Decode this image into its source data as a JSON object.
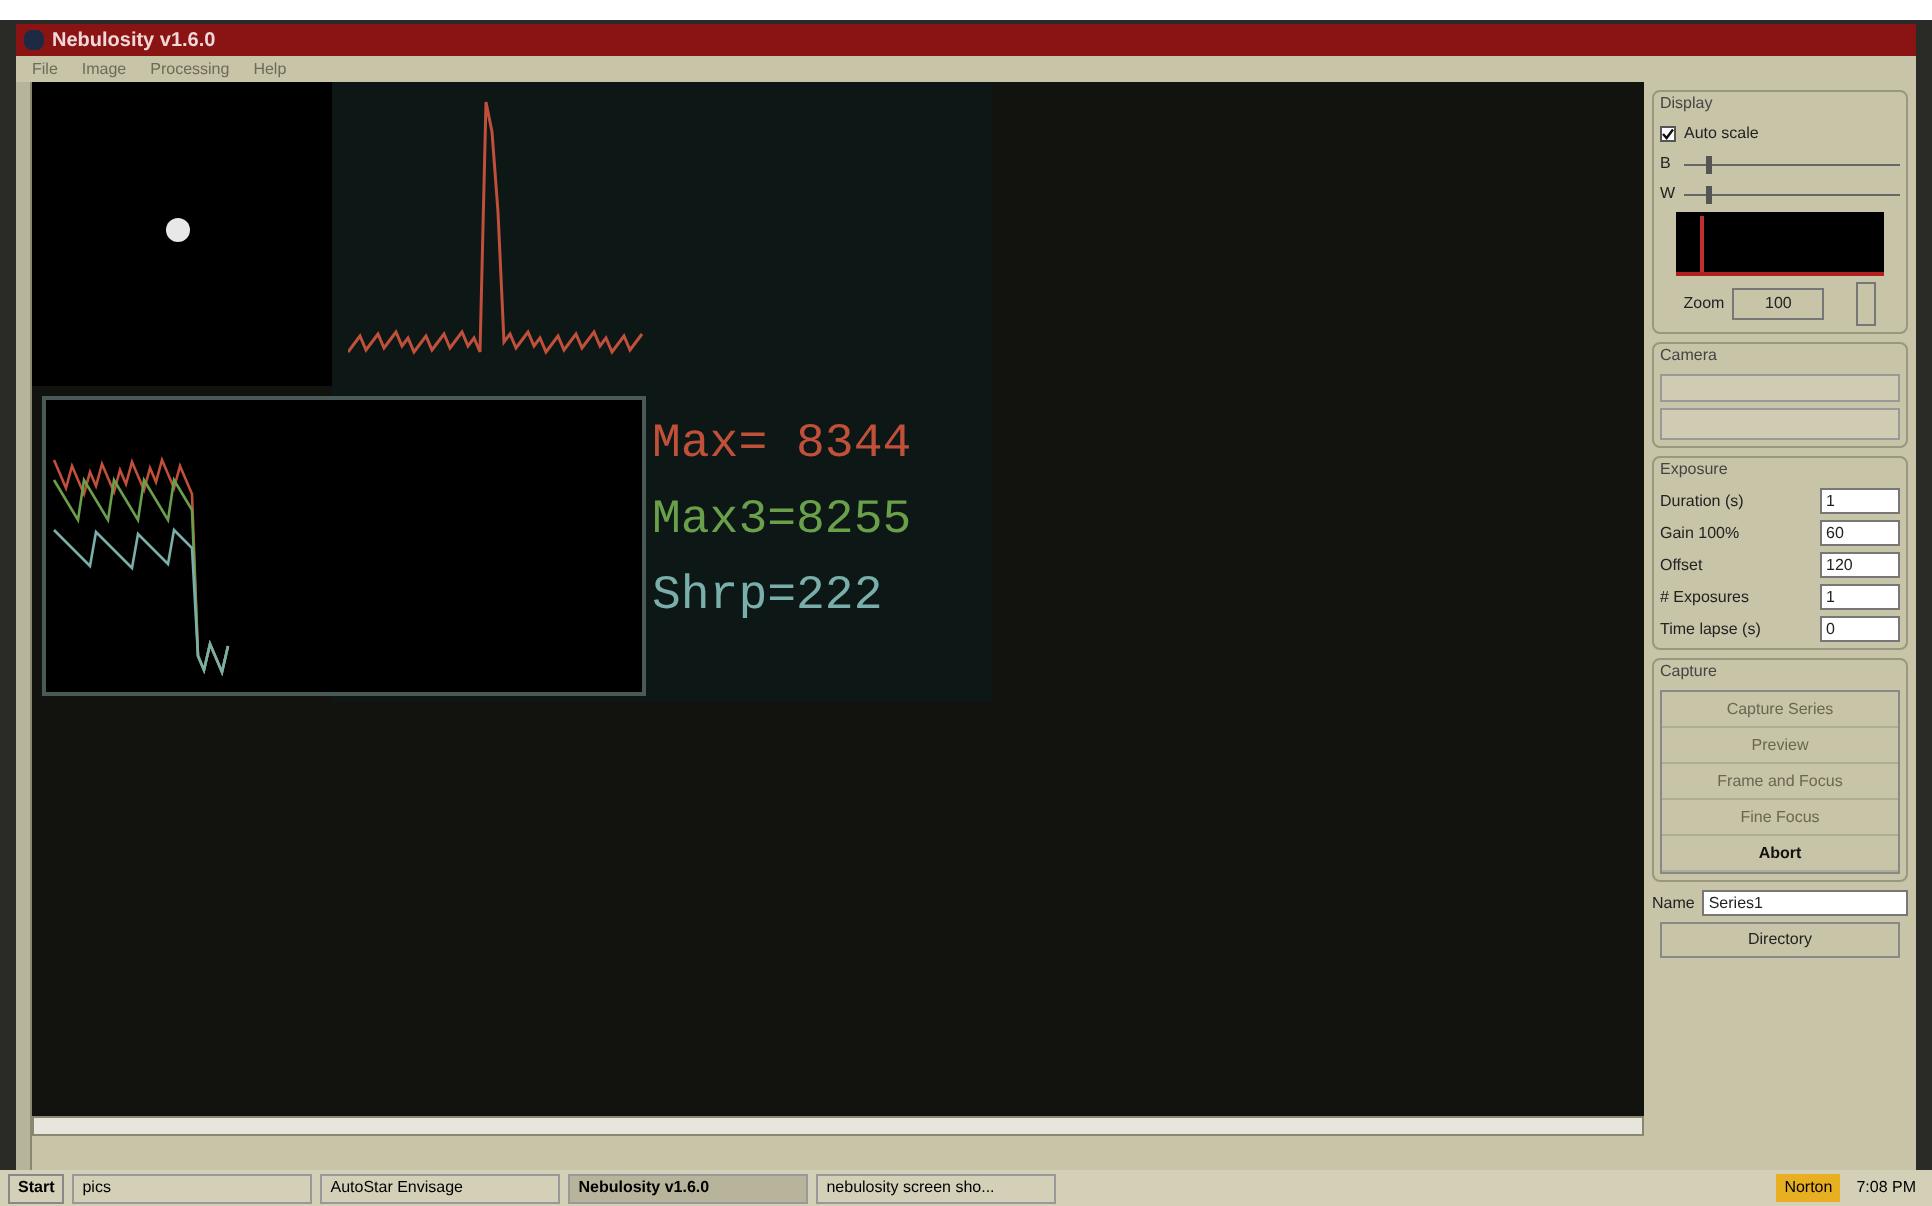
{
  "window": {
    "title": "Nebulosity v1.6.0"
  },
  "menu": [
    "File",
    "Image",
    "Processing",
    "Help"
  ],
  "readouts": [
    {
      "text": "Max= 8344",
      "color": "#c0503a"
    },
    {
      "text": "Max3=8255",
      "color": "#6aa04a"
    },
    {
      "text": "Shrp=222",
      "color": "#7aaeaa"
    }
  ],
  "display": {
    "title": "Display",
    "auto_scale": {
      "label": "Auto scale",
      "checked": true
    },
    "sliders": [
      {
        "label": "B",
        "level": 0.1
      },
      {
        "label": "W",
        "level": 0.1
      }
    ],
    "zoom": {
      "label": "Zoom",
      "value": "100"
    }
  },
  "camera": {
    "title": "Camera"
  },
  "exposure": {
    "title": "Exposure",
    "fields": [
      {
        "label": "Duration (s)",
        "value": "1"
      },
      {
        "label": "Gain 100%",
        "value": "60"
      },
      {
        "label": "Offset",
        "value": "120"
      },
      {
        "label": "# Exposures",
        "value": "1"
      },
      {
        "label": "Time lapse (s)",
        "value": "0"
      }
    ]
  },
  "capture": {
    "title": "Capture",
    "buttons": [
      {
        "label": "Capture Series",
        "disabled": true
      },
      {
        "label": "Preview",
        "disabled": true
      },
      {
        "label": "Frame and Focus",
        "disabled": true
      },
      {
        "label": "Fine Focus",
        "disabled": true
      },
      {
        "label": "Abort",
        "disabled": false
      }
    ],
    "name": {
      "label": "Name",
      "value": "Series1"
    },
    "directory": "Directory"
  },
  "taskbar": {
    "start": "Start",
    "tasks": [
      {
        "label": "pics",
        "selected": false
      },
      {
        "label": "AutoStar Envisage",
        "selected": false
      },
      {
        "label": "Nebulosity v1.6.0",
        "selected": true
      },
      {
        "label": "nebulosity screen sho...",
        "selected": false
      }
    ],
    "tray": "Norton",
    "clock": "7:08 PM"
  }
}
